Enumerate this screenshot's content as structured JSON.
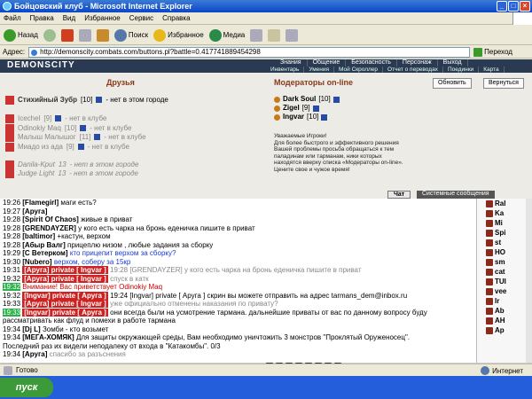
{
  "window": {
    "title": "Бойцовский клуб - Microsoft Internet Explorer"
  },
  "menu": [
    "Файл",
    "Правка",
    "Вид",
    "Избранное",
    "Сервис",
    "Справка"
  ],
  "toolbar": {
    "back": "Назад",
    "search": "Поиск",
    "favorites": "Избранное",
    "media": "Медиа"
  },
  "address": {
    "label": "Адрес:",
    "url": "http://demonscity.combats.com/buttons.pl?battle=0.417741889454298",
    "go": "Переход"
  },
  "site": {
    "brand": "DEMONSCITY",
    "nav_top": [
      "Знания",
      "Общение",
      "Безопасность",
      "Персонаж",
      "Выход"
    ],
    "nav_sub": [
      "Инвентарь",
      "Умения",
      "Мой Скроллер",
      "Отчет о переводах",
      "Поединки",
      "Карта"
    ],
    "friends_title": "Друзья",
    "mods_title": "Модераторы on-line",
    "refresh": "Обновить",
    "back": "Вернуться",
    "friends": [
      {
        "name": "Стихийный Зубр",
        "lvl": "[10]",
        "status": "- нет в этом городе"
      },
      {
        "name": "Icechel",
        "lvl": "[9]",
        "status": "- нет в клубе"
      },
      {
        "name": "Odinokiy Maq",
        "lvl": "[10]",
        "status": "- нет в клубе"
      },
      {
        "name": "Малыш Малышог",
        "lvl": "[11]",
        "status": "- нет в клубе"
      },
      {
        "name": "Миадо из ада",
        "lvl": "[9]",
        "status": "- нет в клубе"
      },
      {
        "name": "Danila-Kput",
        "lvl": "13",
        "status": "- нет в этом городе"
      },
      {
        "name": "Judge Light",
        "lvl": "13",
        "status": "- нет в этом городе"
      }
    ],
    "mods": [
      {
        "name": "Dark Soul",
        "lvl": "[10]"
      },
      {
        "name": "Zigel",
        "lvl": "[9]"
      },
      {
        "name": "Ingvar",
        "lvl": "[10]"
      }
    ],
    "notice": [
      "Уважаемые Игроки!",
      "Для более быстрого и эффективного решения",
      "Вашей проблемы просьба обращаться к тем",
      "паладинам или тарманам, ники которых",
      "находятся вверху списка «Модераторы on-line».",
      "Цените свое и чужое время!"
    ],
    "tab_chat": "Чат",
    "tab_sys": "Системные сообщения"
  },
  "chat": [
    {
      "t": "19:26",
      "n": "[Flamegirl]",
      "m": "маги есть?"
    },
    {
      "t": "19:27",
      "n": "[Аруга]",
      "m": ""
    },
    {
      "t": "19:28",
      "n": "[Spirit Of Chaos]",
      "m": "живые в приват"
    },
    {
      "t": "19:28",
      "n": "[GRENDAYZER]",
      "m": "у кого есть чарка на бронь едeничка пишите в приват"
    },
    {
      "t": "19:28",
      "n": "[baltimor]",
      "m": "+кастун, верхом"
    },
    {
      "t": "19:28",
      "n": "[Абыр Валг]",
      "m": "прицеплю низом , любые задания за сборку"
    },
    {
      "t": "19:29",
      "n": "[С Ветерком]",
      "m": "кто прицепит верхом за сборку?"
    },
    {
      "t": "19:30",
      "n": "[Nubero]",
      "m": "верхом, соберу за 15кр"
    },
    {
      "t": "19:31",
      "n": "",
      "m": ""
    },
    {
      "t": "19:32",
      "n": "",
      "m": ""
    },
    {
      "t": "19:32",
      "n": "",
      "m": "Внимание! Вас приветствует Odinokiy Maq"
    },
    {
      "t": "19:32",
      "n": "",
      "m": ""
    },
    {
      "t": "19:33",
      "n": "[Аруга]",
      "m": "уже официально отменены наказания по привату?"
    },
    {
      "t": "19:33",
      "n": "",
      "m": ""
    },
    {
      "t": "",
      "n": "",
      "m": "рассматривать как флуд и помехи в работе тармана"
    },
    {
      "t": "19:34",
      "n": "[Dj L]",
      "m": "Зомби - кто возьмет"
    },
    {
      "t": "19:34",
      "n": "[МЕГА-ХОМЯК]",
      "m": "Для защиты окружающей среды, Вам необходимо уничтожить 3 монстров \"Проклятый Оруженосец\"."
    },
    {
      "t": "",
      "n": "",
      "m": "Последний раз их видели неподалеку от входа в \"Катакомбы\". 0/3"
    },
    {
      "t": "19:34",
      "n": "[Аруга]",
      "m": "спасибо за разъснения"
    }
  ],
  "private": {
    "ingvar_aruga": "[Ingvar] private [ Аруга ]",
    "aruga_ingvar": "[Аруга] private [ Ingvar ]",
    "m1": "19:28 [GRENDAYZER] у кого есть чарка на бронь едeничка пишите в приват",
    "m2": "спуск в катк",
    "m3": "19:24 [Ingvar] private [ Аруга ] скрин вы можете отправить на адрес tarmans_dem@inbox.ru",
    "m4": "они всегда были на усмотрение тармана. дальнейшие приваты от вас по данному вопросу буду"
  },
  "sidebar": [
    "Ral",
    "Ka",
    "Mi",
    "Spi",
    "st",
    "HO",
    "sm",
    "cat",
    "TUI",
    "vee",
    "Ir",
    "Ab",
    "АН",
    "Ap"
  ],
  "status": {
    "left": "Готово",
    "right": "Интернет"
  },
  "taskbar": {
    "start": "пуск"
  }
}
